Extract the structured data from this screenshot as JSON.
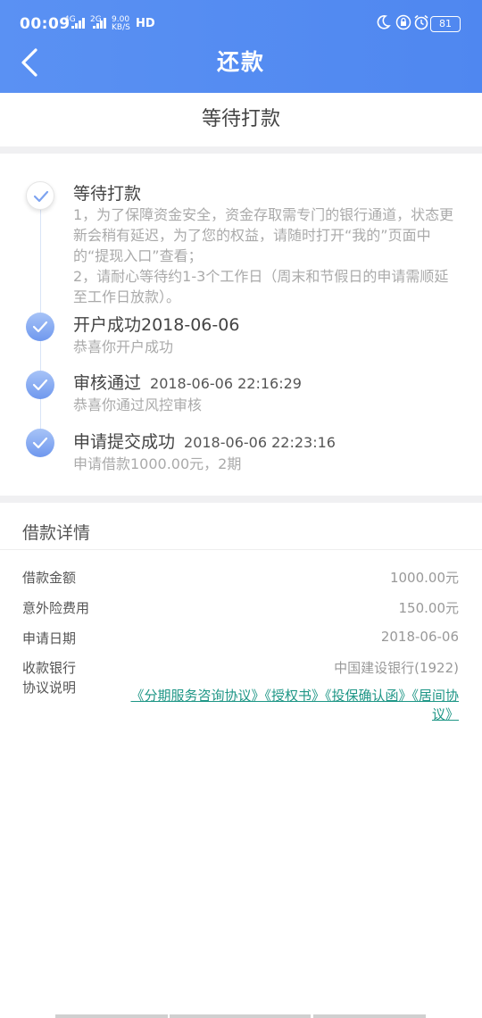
{
  "status_bar": {
    "time": "00:09",
    "sim1": "4G",
    "sim2": "2G",
    "speed_value": "9.00",
    "speed_unit": "KB/S",
    "hd": "HD",
    "battery": "81"
  },
  "header": {
    "title": "还款"
  },
  "banner": {
    "status": "等待打款"
  },
  "timeline": [
    {
      "title": "等待打款",
      "time": "",
      "desc": "1，为了保障资金安全，资金存取需专门的银行通道，状态更新会稍有延迟，为了您的权益，请随时打开“我的”页面中的“提现入口”查看；\n2，请耐心等待约1-3个工作日（周末和节假日的申请需顺延至工作日放款）。"
    },
    {
      "title": "开户成功2018-06-06",
      "time": "",
      "desc": "恭喜你开户成功"
    },
    {
      "title": "审核通过",
      "time": "2018-06-06 22:16:29",
      "desc": "恭喜你通过风控审核"
    },
    {
      "title": "申请提交成功",
      "time": "2018-06-06 22:23:16",
      "desc": "申请借款1000.00元，2期"
    }
  ],
  "details": {
    "title": "借款详情",
    "rows": [
      {
        "label": "借款金额",
        "value": "1000.00元"
      },
      {
        "label": "意外险费用",
        "value": "150.00元"
      },
      {
        "label": "申请日期",
        "value": "2018-06-06"
      },
      {
        "label": "收款银行",
        "value": "中国建设银行(1922)"
      },
      {
        "label": "协议说明",
        "value": ""
      }
    ],
    "agreements": "《分期服务咨询协议》《授权书》《投保确认函》《居间协议》"
  },
  "colors": {
    "header": "#5a91f3",
    "timeline_dot": "#7da3f0",
    "agreement_link": "#1e9686"
  }
}
